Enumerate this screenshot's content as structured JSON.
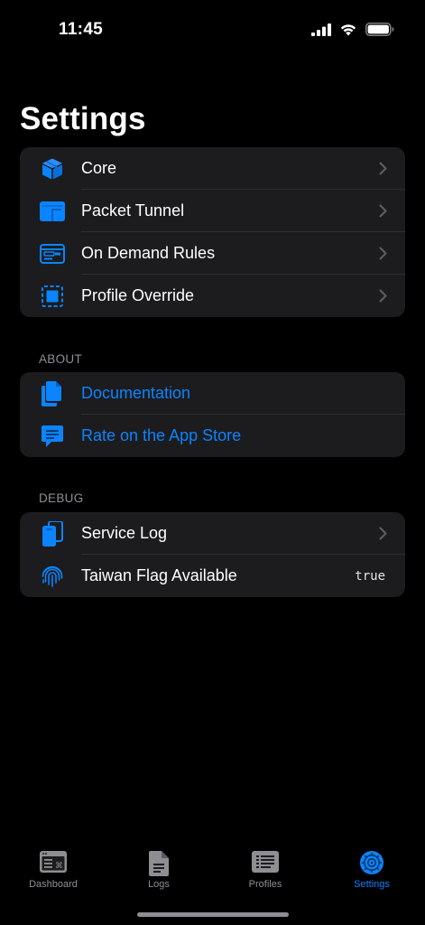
{
  "status": {
    "time": "11:45"
  },
  "page": {
    "title": "Settings"
  },
  "main_group": [
    {
      "label": "Core",
      "icon": "shipping-box-icon"
    },
    {
      "label": "Packet Tunnel",
      "icon": "window-icon"
    },
    {
      "label": "On Demand Rules",
      "icon": "rules-card-icon"
    },
    {
      "label": "Profile Override",
      "icon": "override-frame-icon"
    }
  ],
  "about": {
    "header": "ABOUT",
    "items": [
      {
        "label": "Documentation",
        "icon": "documents-icon"
      },
      {
        "label": "Rate on the App Store",
        "icon": "message-bubble-icon"
      }
    ]
  },
  "debug": {
    "header": "DEBUG",
    "items": [
      {
        "label": "Service Log",
        "icon": "phone-log-icon"
      },
      {
        "label": "Taiwan Flag Available",
        "icon": "fingerprint-icon",
        "value": "true"
      }
    ]
  },
  "tabs": [
    {
      "label": "Dashboard",
      "icon": "terminal-window-icon",
      "active": false
    },
    {
      "label": "Logs",
      "icon": "doc-text-icon",
      "active": false
    },
    {
      "label": "Profiles",
      "icon": "list-rect-icon",
      "active": false
    },
    {
      "label": "Settings",
      "icon": "gear-icon",
      "active": true
    }
  ],
  "colors": {
    "accent": "#0a84ff",
    "background": "#000000",
    "group_bg": "#1c1c1e",
    "secondary_text": "#8e8e93"
  }
}
